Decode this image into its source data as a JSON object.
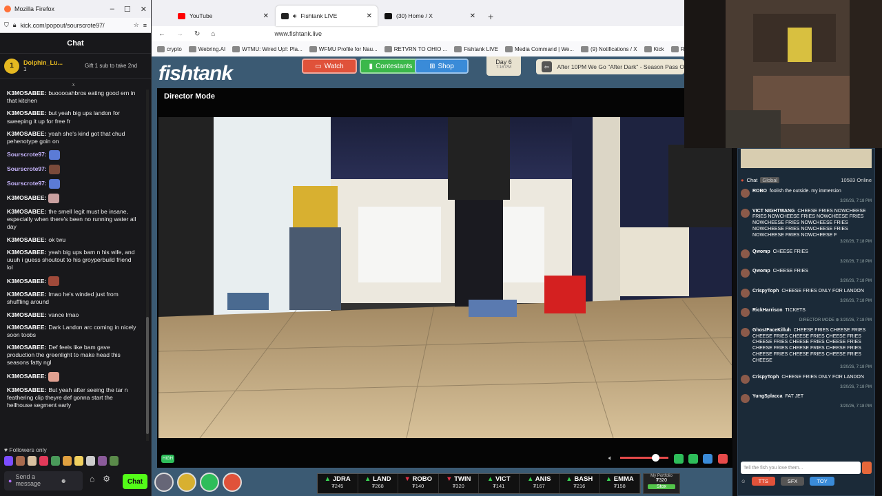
{
  "firefox": {
    "title": "Mozilla Firefox",
    "url": "kick.com/popout/sourscrote97/",
    "chat_title": "Chat",
    "pinned": {
      "name": "Dolphin_Lu...",
      "count": "1",
      "gift": "Gift 1 sub to take 2nd"
    },
    "messages": [
      {
        "user": "K3MOSABEE:",
        "text": "buooooahbros eating good ern in that kitchen"
      },
      {
        "user": "K3MOSABEE:",
        "text": "but yeah big ups landon for sweeping it up for free fr"
      },
      {
        "user": "K3MOSABEE:",
        "text": "yeah she's kind got that chud pehenotype goin on"
      },
      {
        "user": "Sourscrote97:",
        "text": "",
        "emote": "#5b7bd6",
        "purple": true
      },
      {
        "user": "Sourscrote97:",
        "text": "",
        "emote": "#7a4a3a",
        "purple": true
      },
      {
        "user": "Sourscrote97:",
        "text": "",
        "emote": "#5b7bd6",
        "purple": true
      },
      {
        "user": "K3MOSABEE:",
        "text": "",
        "emote": "#c9a0a0"
      },
      {
        "user": "K3MOSABEE:",
        "text": "the smell legit must be insane, especially when there's been no running water all day"
      },
      {
        "user": "K3MOSABEE:",
        "text": "ok twu"
      },
      {
        "user": "K3MOSABEE:",
        "text": "yeah big ups bam n his wife, and uuuh i guess shoutout to his groyperbuild friend lol"
      },
      {
        "user": "K3MOSABEE:",
        "text": "",
        "emote": "#a04a3a"
      },
      {
        "user": "K3MOSABEE:",
        "text": "lmao he's winded just from shuffling around"
      },
      {
        "user": "K3MOSABEE:",
        "text": "vance lmao"
      },
      {
        "user": "K3MOSABEE:",
        "text": "Dark Landon arc coming in nicely soon toobs"
      },
      {
        "user": "K3MOSABEE:",
        "text": "Def feels like bam gave production the greenlight to make head this seasons fatty ngl"
      },
      {
        "user": "K3MOSABEE:",
        "text": "",
        "emote": "#e0a090"
      },
      {
        "user": "K3MOSABEE:",
        "text": "But yeah after seeing the tar n feathering clip theyre def gonna start the hellhouse segment early"
      }
    ],
    "followers": "Followers only",
    "input_placeholder": "Send a message",
    "send": "Chat"
  },
  "browser": {
    "tabs": [
      {
        "label": "YouTube",
        "color": "#ff0000"
      },
      {
        "label": "Fishtank LIVE",
        "color": "#222"
      },
      {
        "label": "(30) Home / X",
        "color": "#111"
      }
    ],
    "url": "www.fishtank.live",
    "bookmarks": [
      "crypto",
      "Webring.AI",
      "WTMU: Wired Up!: Pla...",
      "WFMU Profile for Nau...",
      "RETVRN TO OHIO ...",
      "Fishtank LIVE",
      "Media Command | We...",
      "(9) Notifications / X",
      "Kick",
      "Remilia"
    ]
  },
  "site": {
    "logo": "fishtank",
    "watch": "Watch",
    "contestants": "Contestants",
    "shop": "Shop",
    "day": "Day 6",
    "day_time": "7:16 PM",
    "marquee": "After 10PM We Go \"After Dark\" - Season Pass O",
    "director_mode": "Director Mode",
    "quality": "HIGH"
  },
  "contestants": [
    {
      "name": "JDRA",
      "value": "₮245",
      "dir": "up"
    },
    {
      "name": "LAND",
      "value": "₮268",
      "dir": "up"
    },
    {
      "name": "ROBO",
      "value": "₮140",
      "dir": "dn"
    },
    {
      "name": "TWIN",
      "value": "₮320",
      "dir": "dn"
    },
    {
      "name": "VICT",
      "value": "₮141",
      "dir": "up"
    },
    {
      "name": "ANIS",
      "value": "₮167",
      "dir": "up"
    },
    {
      "name": "BASH",
      "value": "₮216",
      "dir": "up"
    },
    {
      "name": "EMMA",
      "value": "₮158",
      "dir": "up"
    }
  ],
  "portfolio": {
    "label": "My Portfolio",
    "value": "₮320",
    "btn": "Stox"
  },
  "right_chat": {
    "tab": "Chat",
    "global": "Global",
    "online": "10583 Online",
    "messages": [
      {
        "user": "ROBO",
        "text": "foolish the outside. my immersion",
        "ts": "3/20/26, 7:18 PM"
      },
      {
        "user": "VICT NIGHTWANG",
        "text": "CHEESE FRIES NOWCHEESE FRIES NOWCHEESE FRIES NOWCHEESE FRIES NOWCHEESE FRIES NOWCHEESE FRIES NOWCHEESE FRIES NOWCHEESE FRIES NOWCHEESE FRIES NOWCHEESE F",
        "ts": "3/20/26, 7:18 PM"
      },
      {
        "user": "Qwomp",
        "text": "CHEESE FRIES",
        "ts": "3/20/26, 7:18 PM"
      },
      {
        "user": "Qwomp",
        "text": "CHEESE FRIES",
        "ts": "3/20/26, 7:18 PM"
      },
      {
        "user": "CrispyToph",
        "text": "CHEESE FRIES ONLY FOR LANDON",
        "ts": "3/20/26, 7:18 PM"
      },
      {
        "user": "RickHarrison",
        "text": "TICKETS",
        "ts": "DIRECTOR MODE ⊕ 3/20/26, 7:18 PM"
      },
      {
        "user": "GhostFaceKilluh",
        "text": "CHEESE FRIES CHEESE FRIES CHEESE FRIES CHEESE FRIES CHEESE FRIES CHEESE FRIES CHEESE FRIES CHEESE FRIES CHEESE FRIES CHEESE FRIES CHEESE FRIES CHEESE FRIES CHEESE FRIES CHEESE FRIES CHEESE",
        "ts": "3/20/26, 7:18 PM"
      },
      {
        "user": "CrispyToph",
        "text": "CHEESE FRIES ONLY FOR LANDON",
        "ts": "3/20/26, 7:18 PM"
      },
      {
        "user": "YungSplacca",
        "text": "FAT JET",
        "ts": "3/20/26, 7:18 PM"
      }
    ],
    "input_placeholder": "Tell the fish you love them...",
    "tts": "TTS",
    "sfx": "SFX",
    "toy": "TOY"
  }
}
